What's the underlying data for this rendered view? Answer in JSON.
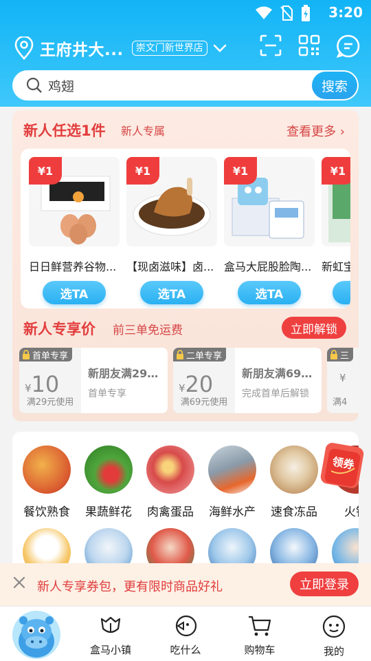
{
  "status_bar": {
    "time": "3:20"
  },
  "header": {
    "location": "王府井大...",
    "store": "崇文门新世界店",
    "search_placeholder": "鸡翅",
    "search_button": "搜索"
  },
  "newcomer_pick": {
    "title": "新人任选1件",
    "subtitle": "新人专属",
    "more": "查看更多 ›",
    "items": [
      {
        "price": "¥1",
        "name": "日日鲜营养谷物...",
        "button": "选TA"
      },
      {
        "price": "¥1",
        "name": "【现卤滋味】卤...",
        "button": "选TA"
      },
      {
        "price": "¥1",
        "name": "盒马大屁股脸陶...",
        "button": "选TA"
      },
      {
        "price": "¥1",
        "name": "新虹宝",
        "button": ""
      }
    ]
  },
  "newcomer_price": {
    "title": "新人专享价",
    "subtitle": "前三单免运费",
    "unlock": "立即解锁",
    "coupons": [
      {
        "badge": "首单专享",
        "currency": "¥",
        "amount": "10",
        "condition": "满29元使用",
        "title": "新朋友满29减...",
        "desc": "首单专享"
      },
      {
        "badge": "二单专享",
        "currency": "¥",
        "amount": "20",
        "condition": "满69元使用",
        "title": "新朋友满69减...",
        "desc": "完成首单后解锁"
      },
      {
        "badge": "三",
        "currency": "¥",
        "amount": "",
        "condition": "满4",
        "title": "",
        "desc": ""
      }
    ]
  },
  "categories": [
    {
      "label": "餐饮熟食",
      "color": "#d9582f"
    },
    {
      "label": "果蔬鲜花",
      "color": "#4fa63c"
    },
    {
      "label": "肉禽蛋品",
      "color": "#d84a4a"
    },
    {
      "label": "海鲜水产",
      "color": "#8a9aa8"
    },
    {
      "label": "速食冻品",
      "color": "#c9a274"
    },
    {
      "label": "火锅",
      "color": "#b53a2d"
    }
  ],
  "coupon_float": {
    "label": "领券"
  },
  "login_banner": {
    "text": "新人专享券包，更有限时商品好礼",
    "button": "立即登录"
  },
  "tabs": [
    {
      "label": "盒马小镇",
      "icon": "tulip-icon"
    },
    {
      "label": "吃什么",
      "icon": "fish-chat-icon"
    },
    {
      "label": "购物车",
      "icon": "cart-icon"
    },
    {
      "label": "我的",
      "icon": "smiley-icon"
    }
  ]
}
